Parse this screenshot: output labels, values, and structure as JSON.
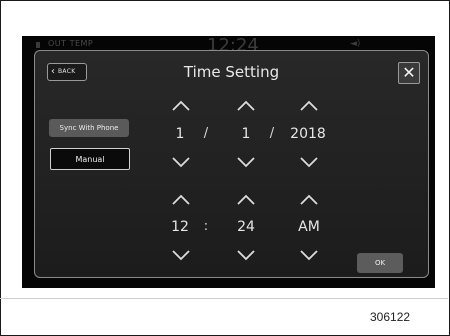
{
  "status_bar": {
    "out_temp_label": "OUT TEMP",
    "clock": "12:24",
    "volume_glyph": "◄)"
  },
  "dialog": {
    "title": "Time Setting",
    "back_label": "BACK",
    "back_icon": "chevron-left-icon",
    "close_icon": "close-icon",
    "close_glyph": "✕",
    "sync_label": "Sync With Phone",
    "manual_label": "Manual",
    "ok_label": "OK"
  },
  "date": {
    "month": "1",
    "day": "1",
    "year": "2018",
    "separator1": "/",
    "separator2": "/"
  },
  "time": {
    "hour": "12",
    "minute": "24",
    "ampm": "AM",
    "separator": ":"
  },
  "figure_id": "306122",
  "colors": {
    "screen_bg": "#050505",
    "dialog_bg": "#222222",
    "button_gray": "#5a5a5a",
    "text": "#e6e6e6"
  }
}
